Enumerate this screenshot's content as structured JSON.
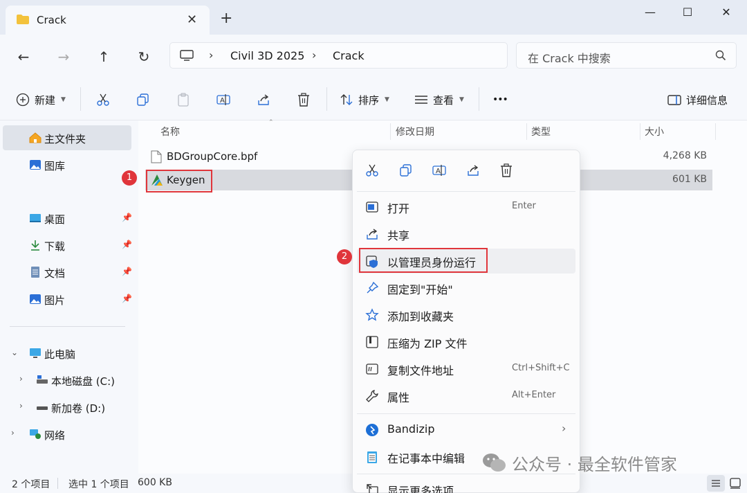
{
  "tab": {
    "title": "Crack",
    "close": "✕",
    "new": "+"
  },
  "window_buttons": {
    "minimize": "—",
    "maximize": "☐",
    "close": "✕"
  },
  "address": {
    "segments": [
      "Civil 3D 2025",
      "Crack"
    ],
    "separator": "›"
  },
  "search": {
    "placeholder": "在 Crack 中搜索"
  },
  "toolbar": {
    "new_label": "新建",
    "sort_label": "排序",
    "view_label": "查看",
    "more_label": "•••",
    "details_label": "详细信息"
  },
  "sidebar": {
    "home": "主文件夹",
    "gallery": "图库",
    "quick": [
      "桌面",
      "下载",
      "文档",
      "图片"
    ],
    "this_pc": "此电脑",
    "drives": [
      "本地磁盘 (C:)",
      "新加卷 (D:)"
    ],
    "network": "网络"
  },
  "columns": {
    "name": "名称",
    "modified": "修改日期",
    "type": "类型",
    "size": "大小"
  },
  "files": [
    {
      "name": "BDGroupCore.bpf",
      "size": "4,268 KB"
    },
    {
      "name": "Keygen",
      "size": "601 KB"
    }
  ],
  "badges": [
    "1",
    "2"
  ],
  "context_menu": {
    "items": [
      {
        "label": "打开",
        "accel": "Enter"
      },
      {
        "label": "共享",
        "accel": ""
      },
      {
        "label": "以管理员身份运行",
        "accel": ""
      },
      {
        "label": "固定到\"开始\"",
        "accel": ""
      },
      {
        "label": "添加到收藏夹",
        "accel": ""
      },
      {
        "label": "压缩为 ZIP 文件",
        "accel": ""
      },
      {
        "label": "复制文件地址",
        "accel": "Ctrl+Shift+C"
      },
      {
        "label": "属性",
        "accel": "Alt+Enter"
      },
      {
        "label": "Bandizip",
        "accel": "›"
      },
      {
        "label": "在记事本中编辑",
        "accel": ""
      },
      {
        "label": "显示更多选项",
        "accel": ""
      }
    ]
  },
  "status": {
    "count": "2 个项目",
    "selection": "选中 1 个项目",
    "size": "600 KB"
  },
  "watermark": {
    "text": "公众号 · 最全软件管家"
  },
  "colors": {
    "accent": "#e0353b",
    "folder": "#f3c23c",
    "blue": "#2b6fd6"
  }
}
